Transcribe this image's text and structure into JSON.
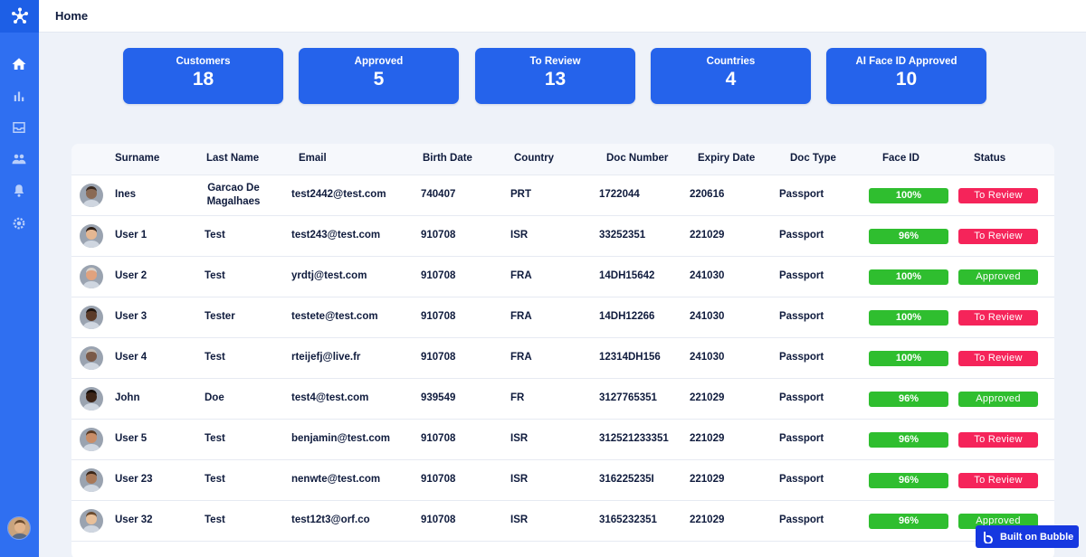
{
  "header": {
    "title": "Home"
  },
  "stats": [
    {
      "label": "Customers",
      "value": "18"
    },
    {
      "label": "Approved",
      "value": "5"
    },
    {
      "label": "To Review",
      "value": "13"
    },
    {
      "label": "Countries",
      "value": "4"
    },
    {
      "label": "AI Face ID Approved",
      "value": "10"
    }
  ],
  "table": {
    "columns": [
      "Surname",
      "Last Name",
      "Email",
      "Birth Date",
      "Country",
      "Doc Number",
      "Expiry Date",
      "Doc Type",
      "Face ID",
      "Status"
    ],
    "rows": [
      {
        "surname": "Ines",
        "last_name": "Garcao De Magalhaes",
        "email": "test2442@test.com",
        "birth_date": "740407",
        "country": "PRT",
        "doc_number": "1722044",
        "expiry_date": "220616",
        "doc_type": "Passport",
        "face_id": "100%",
        "status": "To Review"
      },
      {
        "surname": "User 1",
        "last_name": "Test",
        "email": "test243@test.com",
        "birth_date": "910708",
        "country": "ISR",
        "doc_number": "33252351",
        "expiry_date": "221029",
        "doc_type": "Passport",
        "face_id": "96%",
        "status": "To Review"
      },
      {
        "surname": "User 2",
        "last_name": "Test",
        "email": "yrdtj@test.com",
        "birth_date": "910708",
        "country": "FRA",
        "doc_number": "14DH15642",
        "expiry_date": "241030",
        "doc_type": "Passport",
        "face_id": "100%",
        "status": "Approved"
      },
      {
        "surname": "User 3",
        "last_name": "Tester",
        "email": "testete@test.com",
        "birth_date": "910708",
        "country": "FRA",
        "doc_number": "14DH12266",
        "expiry_date": "241030",
        "doc_type": "Passport",
        "face_id": "100%",
        "status": "To Review"
      },
      {
        "surname": "User 4",
        "last_name": "Test",
        "email": "rteijefj@live.fr",
        "birth_date": "910708",
        "country": "FRA",
        "doc_number": "12314DH156",
        "expiry_date": "241030",
        "doc_type": "Passport",
        "face_id": "100%",
        "status": "To Review"
      },
      {
        "surname": "John",
        "last_name": "Doe",
        "email": "test4@test.com",
        "birth_date": "939549",
        "country": "FR",
        "doc_number": "3127765351",
        "expiry_date": "221029",
        "doc_type": "Passport",
        "face_id": "96%",
        "status": "Approved"
      },
      {
        "surname": "User 5",
        "last_name": "Test",
        "email": "benjamin@test.com",
        "birth_date": "910708",
        "country": "ISR",
        "doc_number": "312521233351",
        "expiry_date": "221029",
        "doc_type": "Passport",
        "face_id": "96%",
        "status": "To Review"
      },
      {
        "surname": "User 23",
        "last_name": "Test",
        "email": "nenwte@test.com",
        "birth_date": "910708",
        "country": "ISR",
        "doc_number": "316225235I",
        "expiry_date": "221029",
        "doc_type": "Passport",
        "face_id": "96%",
        "status": "To Review"
      },
      {
        "surname": "User 32",
        "last_name": "Test",
        "email": "test12t3@orf.co",
        "birth_date": "910708",
        "country": "ISR",
        "doc_number": "3165232351",
        "expiry_date": "221029",
        "doc_type": "Passport",
        "face_id": "96%",
        "status": "Approved"
      }
    ]
  },
  "badge": {
    "label": "Built on Bubble"
  },
  "colors": {
    "accent": "#2563eb",
    "sidebar": "#2f6ff1",
    "approved": "#2fbe2f",
    "review": "#f5245a"
  }
}
